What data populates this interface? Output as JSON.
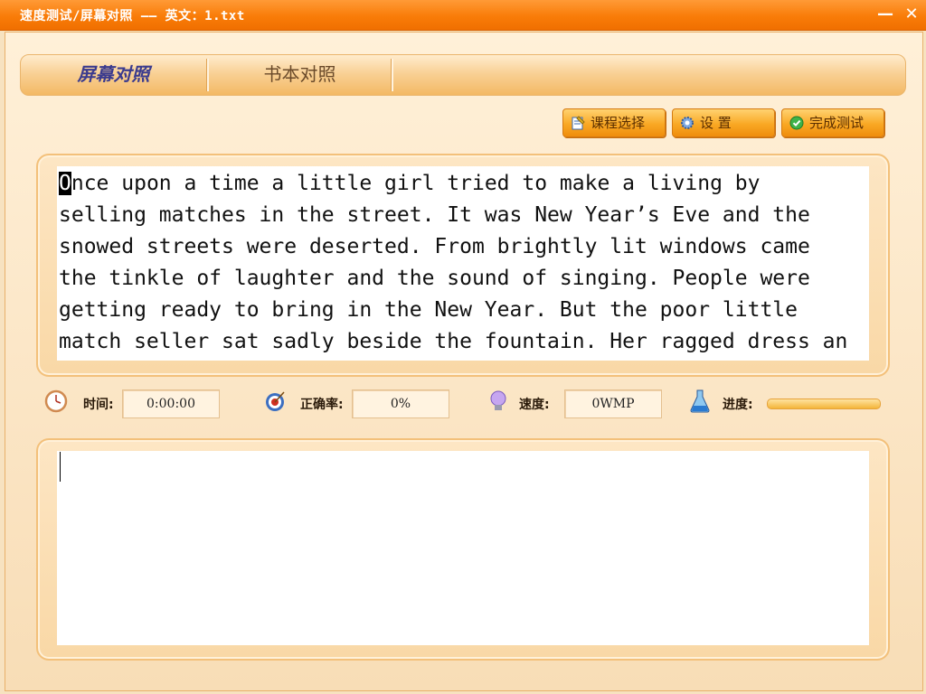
{
  "window": {
    "title": "速度测试/屏幕对照 —— 英文：1.txt",
    "minimize": "—",
    "close": "✕"
  },
  "tabs": [
    {
      "label": "屏幕对照",
      "active": true
    },
    {
      "label": "书本对照",
      "active": false
    }
  ],
  "toolbar": {
    "course_label": "课程选择",
    "settings_label": "设 置",
    "finish_label": "完成测试"
  },
  "reference": {
    "first_char": "O",
    "lines": [
      "nce upon a time a little girl tried to make a living by",
      "selling matches in the street. It was New Year’s Eve and the",
      "snowed streets were deserted. From brightly lit windows came",
      "the tinkle of laughter and the sound of singing. People were",
      "getting ready to bring in the New Year. But the poor little",
      "match seller sat sadly beside the fountain. Her ragged dress an"
    ]
  },
  "stats": {
    "time_label": "时间:",
    "time_value": "0:00:00",
    "accuracy_label": "正确率:",
    "accuracy_value": "0%",
    "speed_label": "速度:",
    "speed_value": "0WMP",
    "progress_label": "进度:",
    "progress_fraction": 0
  },
  "input": {
    "value": ""
  },
  "colors": {
    "titlebar": "#f97c08",
    "background": "#f8ddb6",
    "tab_active_text": "#3b3b8e",
    "button": "#f9a824"
  }
}
